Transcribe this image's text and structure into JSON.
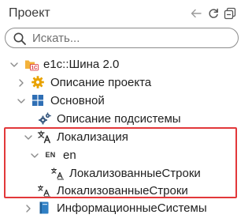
{
  "header": {
    "title": "Проект"
  },
  "search": {
    "placeholder": "Искать..."
  },
  "tree": {
    "root": {
      "label": "e1c::Шина 2.0",
      "badge": "1C"
    },
    "project_description": {
      "label": "Описание проекта"
    },
    "main": {
      "label": "Основной"
    },
    "subsystem_description": {
      "label": "Описание подсистемы"
    },
    "localization": {
      "label": "Локализация"
    },
    "en": {
      "label": "en",
      "tag": "EN"
    },
    "en_strings": {
      "label": "ЛокализованныеСтроки"
    },
    "strings": {
      "label": "ЛокализованныеСтроки"
    },
    "info_systems": {
      "label": "ИнформационныеСистемы"
    }
  },
  "colors": {
    "highlight": "#e2383a",
    "gear": "#e8a200",
    "main_icon": "#2f6fb5",
    "folder": "#f3b23b",
    "badge": "#d7262d"
  }
}
